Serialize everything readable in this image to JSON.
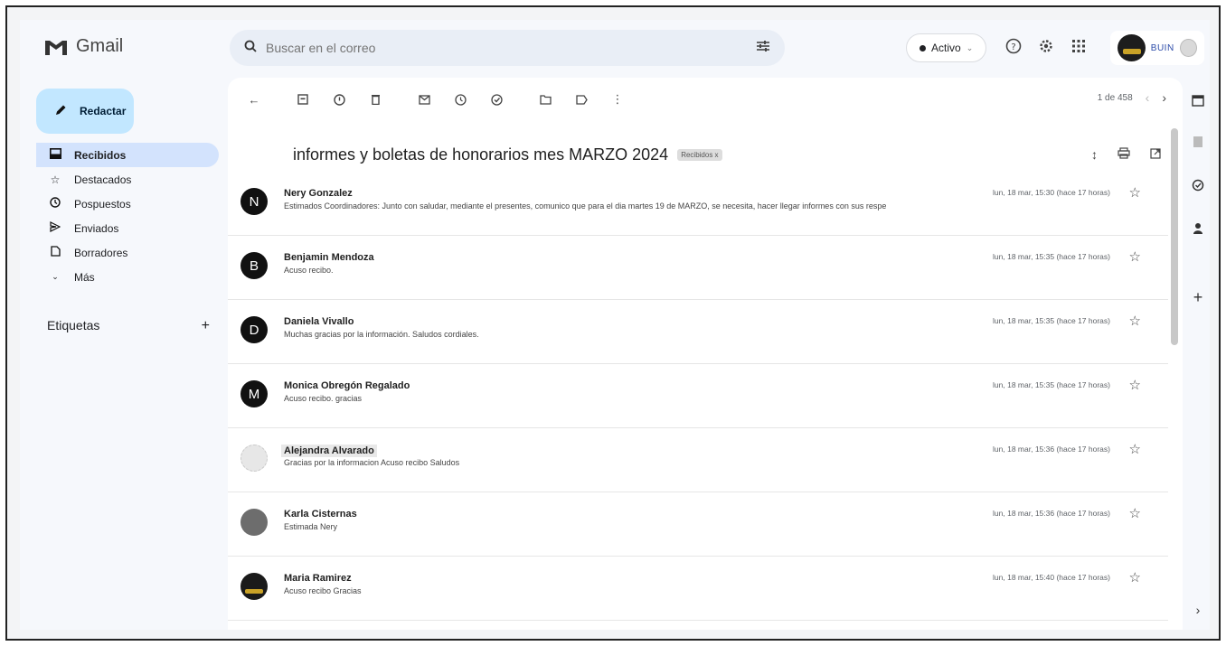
{
  "app": {
    "name": "Gmail",
    "colors": {
      "compose_bg": "#c2e7ff",
      "active_nav_bg": "#d3e3fd",
      "search_bg": "#e9eef6",
      "panel_bg": "#f6f8fc"
    }
  },
  "header": {
    "search_placeholder": "Buscar en el correo",
    "status_label": "Activo",
    "account_name": "BUIN"
  },
  "sidebar": {
    "compose_label": "Redactar",
    "items": [
      {
        "label": "Recibidos",
        "icon": "inbox-icon"
      },
      {
        "label": "Destacados",
        "icon": "star-icon"
      },
      {
        "label": "Pospuestos",
        "icon": "clock-icon"
      },
      {
        "label": "Enviados",
        "icon": "send-icon"
      },
      {
        "label": "Borradores",
        "icon": "draft-icon"
      },
      {
        "label": "Más",
        "icon": "chevron-down-icon"
      }
    ],
    "labels_title": "Etiquetas"
  },
  "thread": {
    "pager_text": "1 de 458",
    "subject": "informes y boletas de honorarios mes MARZO 2024",
    "label_chip": "Recibidos x",
    "messages": [
      {
        "initial": "N",
        "sender": "Nery Gonzalez",
        "snippet": "Estimados Coordinadores: Junto con saludar, mediante el presentes, comunico que para el dia martes 19 de MARZO, se necesita, hacer llegar informes con sus respe",
        "time": "lun, 18 mar, 15:30 (hace 17 horas)"
      },
      {
        "initial": "B",
        "sender": "Benjamin Mendoza",
        "snippet": "Acuso recibo.",
        "time": "lun, 18 mar, 15:35 (hace 17 horas)"
      },
      {
        "initial": "D",
        "sender": "Daniela Vivallo",
        "snippet": "Muchas gracias por la información. Saludos cordiales.",
        "time": "lun, 18 mar, 15:35 (hace 17 horas)"
      },
      {
        "initial": "M",
        "sender": "Monica Obregón Regalado",
        "snippet": "Acuso recibo. gracias",
        "time": "lun, 18 mar, 15:35 (hace 17 horas)"
      },
      {
        "initial": "",
        "sender": "Alejandra Alvarado",
        "snippet": "Gracias por la informacion Acuso recibo Saludos",
        "time": "lun, 18 mar, 15:36 (hace 17 horas)"
      },
      {
        "initial": "",
        "sender": "Karla Cisternas",
        "snippet": "Estimada Nery",
        "time": "lun, 18 mar, 15:36 (hace 17 horas)"
      },
      {
        "initial": "",
        "sender": "Maria Ramirez",
        "snippet": "Acuso recibo Gracias",
        "time": "lun, 18 mar, 15:40 (hace 17 horas)"
      }
    ]
  }
}
